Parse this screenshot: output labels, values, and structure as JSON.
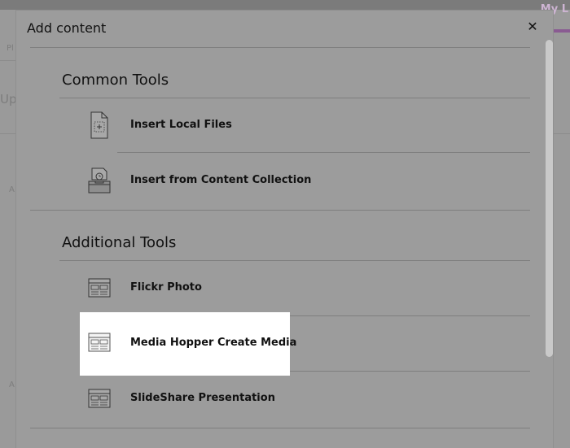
{
  "background": {
    "user_menu": "My L",
    "fragments": [
      "Pl",
      "Upl",
      "A",
      "A"
    ]
  },
  "modal": {
    "title": "Add content",
    "close_glyph": "✕"
  },
  "sections": {
    "common": {
      "title": "Common Tools",
      "items": [
        {
          "label": "Insert Local Files",
          "icon": "file-upload-icon"
        },
        {
          "label": "Insert from Content Collection",
          "icon": "content-collection-icon"
        }
      ]
    },
    "additional": {
      "title": "Additional Tools",
      "items": [
        {
          "label": "Flickr Photo",
          "icon": "web-page-icon"
        },
        {
          "label": "Media Hopper Create Media",
          "icon": "web-page-icon",
          "highlighted": true
        },
        {
          "label": "SlideShare Presentation",
          "icon": "web-page-icon"
        }
      ]
    }
  },
  "colors": {
    "overlay": "#9a9a9a",
    "highlight": "#ffffff",
    "brand_purple": "#8a5b92"
  }
}
